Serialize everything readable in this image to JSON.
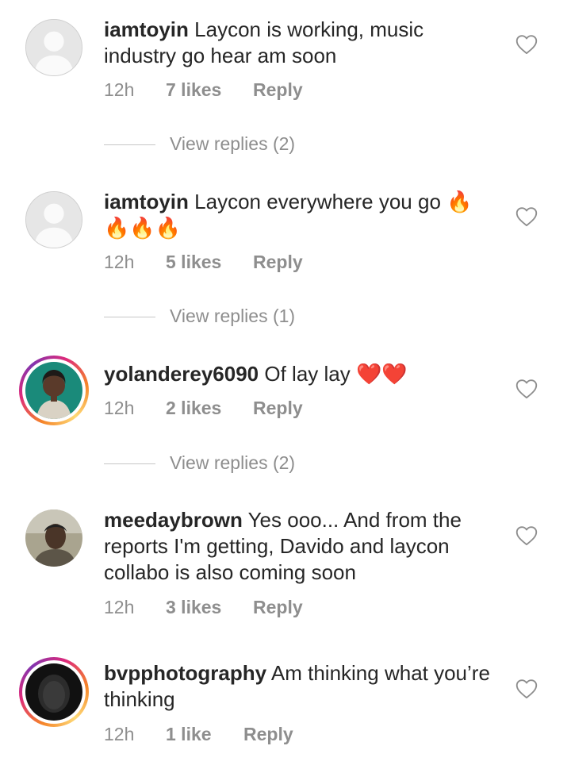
{
  "comments": [
    {
      "username": "iamtoyin",
      "text": "Laycon is working, music industry go hear am soon",
      "time": "12h",
      "likes": "7 likes",
      "reply": "Reply",
      "view_replies": "View replies (2)"
    },
    {
      "username": "iamtoyin",
      "text": "Laycon everywhere you go 🔥🔥🔥🔥",
      "time": "12h",
      "likes": "5 likes",
      "reply": "Reply",
      "view_replies": "View replies (1)"
    },
    {
      "username": "yolanderey6090",
      "text": "Of lay lay ❤️❤️",
      "time": "12h",
      "likes": "2 likes",
      "reply": "Reply",
      "view_replies": "View replies (2)"
    },
    {
      "username": "meedaybrown",
      "text": "Yes ooo... And from  the reports I'm getting, Davido and laycon collabo is also coming soon",
      "time": "12h",
      "likes": "3 likes",
      "reply": "Reply"
    },
    {
      "username": "bvpphotography",
      "text": "Am thinking what you’re thinking",
      "time": "12h",
      "likes": "1 like",
      "reply": "Reply"
    }
  ],
  "icons": {
    "like": "heart-outline-icon",
    "default_avatar": "person-silhouette-icon"
  },
  "colors": {
    "text": "#262626",
    "secondary": "#8e8e8e",
    "story_ring_start": "#f58529",
    "story_ring_end": "#dd2a7b"
  }
}
